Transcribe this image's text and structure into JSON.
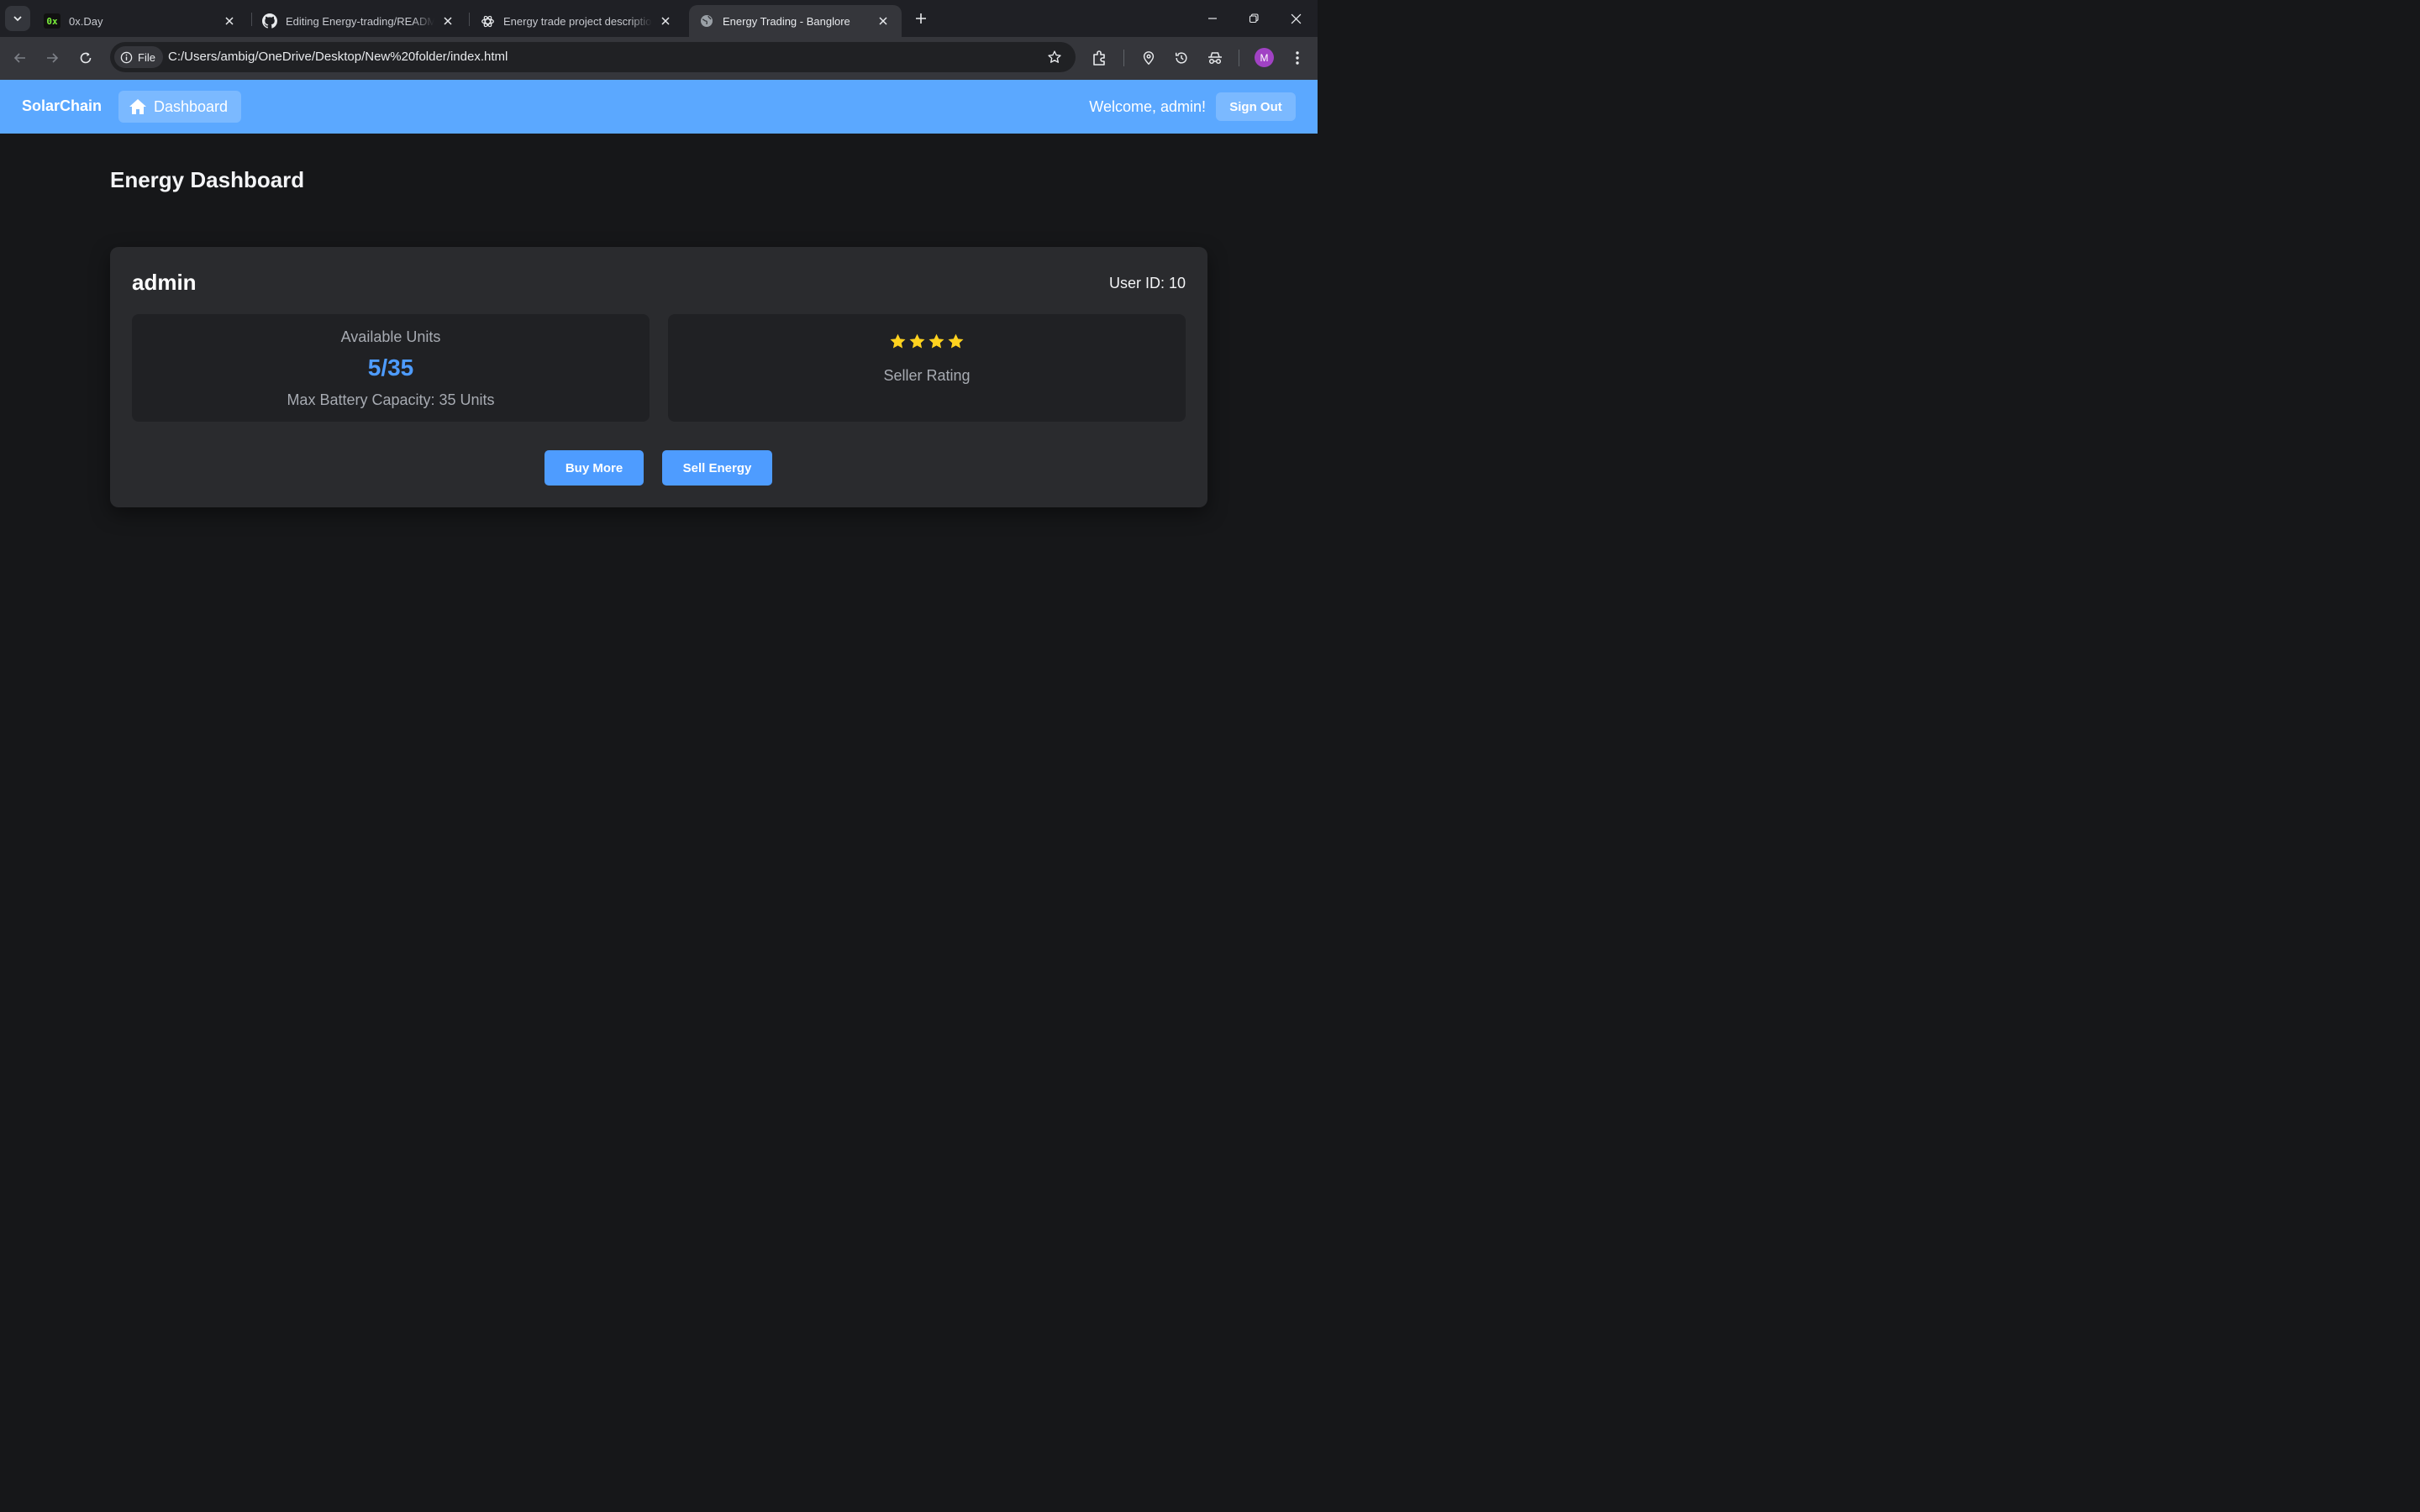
{
  "browser": {
    "tabs": [
      {
        "title": "0x.Day",
        "favicon": "0x-favicon"
      },
      {
        "title": "Editing Energy-trading/README.md",
        "favicon": "github-icon"
      },
      {
        "title": "Energy trade project description",
        "favicon": "chatgpt-icon"
      },
      {
        "title": "Energy Trading - Banglore",
        "favicon": "globe-icon",
        "active": true
      }
    ],
    "favicon_0x_text": "0x",
    "file_chip": "File",
    "url": "C:/Users/ambig/OneDrive/Desktop/New%20folder/index.html",
    "avatar_letter": "M",
    "avatar_color": "#a142c4"
  },
  "app": {
    "brand": "SolarChain",
    "nav_dashboard": "Dashboard",
    "welcome": "Welcome, admin!",
    "signout": "Sign Out",
    "accent_color": "#5ba8ff"
  },
  "dashboard": {
    "title": "Energy Dashboard",
    "username": "admin",
    "user_id": "User ID: 10",
    "units_label": "Available Units",
    "units_value": "5/35",
    "capacity": "Max Battery Capacity: 35 Units",
    "rating_stars": 4,
    "star_color": "#ffd21f",
    "rating_label": "Seller Rating",
    "buy_button": "Buy More",
    "sell_button": "Sell Energy"
  }
}
